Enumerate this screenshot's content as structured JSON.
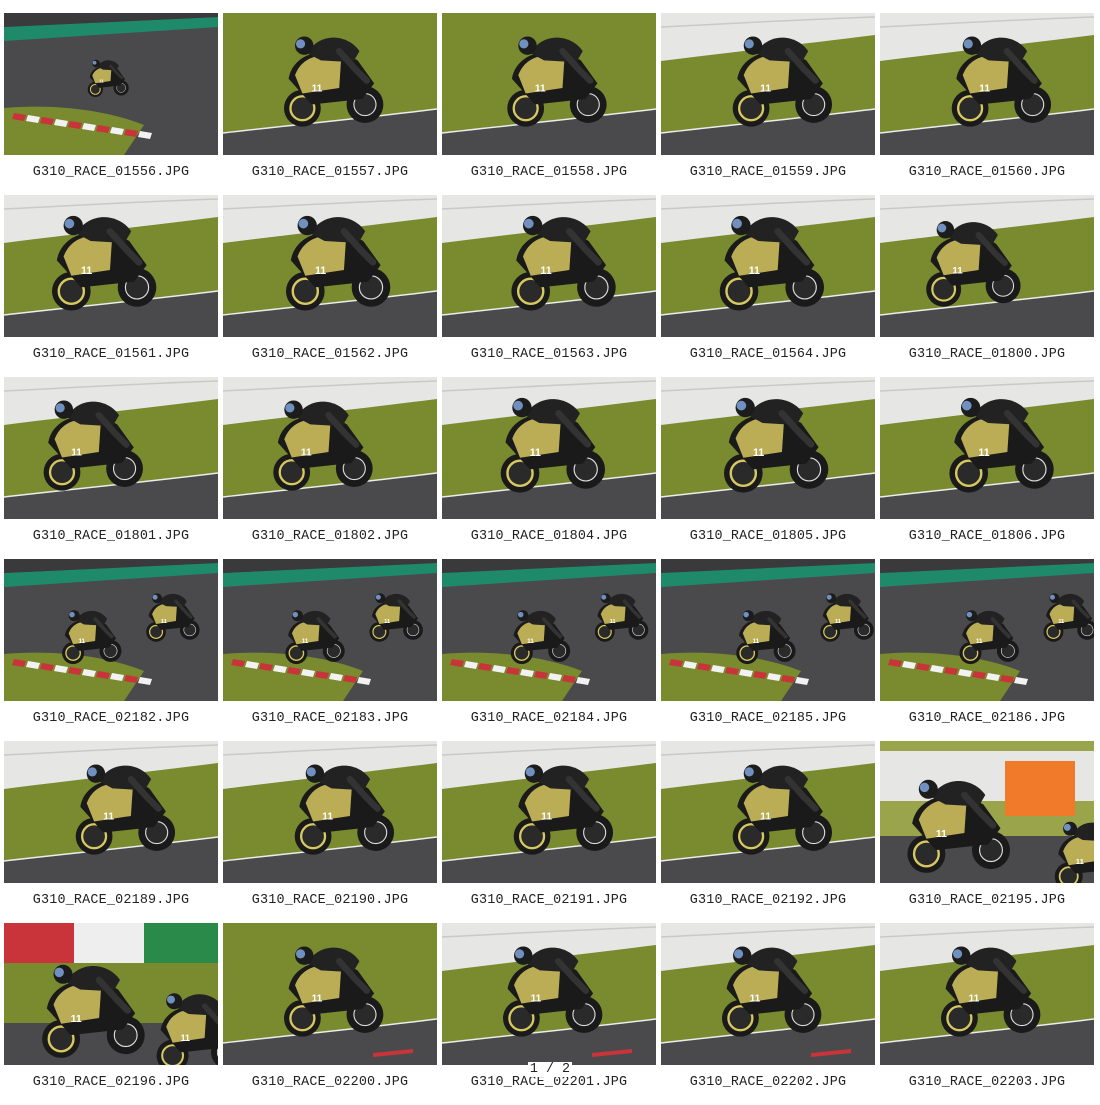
{
  "gallery": {
    "items": [
      {
        "filename": "G310_RACE_01556.JPG",
        "scene": "track-far",
        "x": 0.48,
        "s": 0.38,
        "kerb": true,
        "bg": "track"
      },
      {
        "filename": "G310_RACE_01557.JPG",
        "scene": "grass",
        "x": 0.5,
        "s": 1.0,
        "kerb": false,
        "bg": "grass"
      },
      {
        "filename": "G310_RACE_01558.JPG",
        "scene": "grass",
        "x": 0.52,
        "s": 1.0,
        "kerb": false,
        "bg": "grass"
      },
      {
        "filename": "G310_RACE_01559.JPG",
        "scene": "grass",
        "x": 0.55,
        "s": 1.0,
        "kerb": false,
        "bg": "grass-wall"
      },
      {
        "filename": "G310_RACE_01560.JPG",
        "scene": "grass",
        "x": 0.55,
        "s": 1.0,
        "kerb": false,
        "bg": "grass-wall"
      },
      {
        "filename": "G310_RACE_01561.JPG",
        "scene": "wall",
        "x": 0.45,
        "s": 1.05,
        "kerb": false,
        "bg": "grass-wall"
      },
      {
        "filename": "G310_RACE_01562.JPG",
        "scene": "wall",
        "x": 0.52,
        "s": 1.05,
        "kerb": false,
        "bg": "grass-wall"
      },
      {
        "filename": "G310_RACE_01563.JPG",
        "scene": "wall",
        "x": 0.55,
        "s": 1.05,
        "kerb": false,
        "bg": "grass-wall"
      },
      {
        "filename": "G310_RACE_01564.JPG",
        "scene": "wall",
        "x": 0.5,
        "s": 1.05,
        "kerb": false,
        "bg": "grass-wall"
      },
      {
        "filename": "G310_RACE_01800.JPG",
        "scene": "wall",
        "x": 0.42,
        "s": 0.95,
        "kerb": false,
        "bg": "grass-wall"
      },
      {
        "filename": "G310_RACE_01801.JPG",
        "scene": "wall",
        "x": 0.4,
        "s": 1.0,
        "kerb": false,
        "bg": "grass-wall"
      },
      {
        "filename": "G310_RACE_01802.JPG",
        "scene": "wall",
        "x": 0.45,
        "s": 1.0,
        "kerb": false,
        "bg": "grass-wall"
      },
      {
        "filename": "G310_RACE_01804.JPG",
        "scene": "wall",
        "x": 0.5,
        "s": 1.05,
        "kerb": false,
        "bg": "grass-wall"
      },
      {
        "filename": "G310_RACE_01805.JPG",
        "scene": "wall",
        "x": 0.52,
        "s": 1.05,
        "kerb": false,
        "bg": "grass-wall"
      },
      {
        "filename": "G310_RACE_01806.JPG",
        "scene": "wall",
        "x": 0.55,
        "s": 1.05,
        "kerb": false,
        "bg": "grass-wall"
      },
      {
        "filename": "G310_RACE_02182.JPG",
        "scene": "track-two",
        "x": 0.4,
        "s": 0.55,
        "kerb": true,
        "bg": "track"
      },
      {
        "filename": "G310_RACE_02183.JPG",
        "scene": "track-two",
        "x": 0.42,
        "s": 0.55,
        "kerb": true,
        "bg": "track"
      },
      {
        "filename": "G310_RACE_02184.JPG",
        "scene": "track-two",
        "x": 0.45,
        "s": 0.55,
        "kerb": true,
        "bg": "track"
      },
      {
        "filename": "G310_RACE_02185.JPG",
        "scene": "track-two",
        "x": 0.48,
        "s": 0.55,
        "kerb": true,
        "bg": "track"
      },
      {
        "filename": "G310_RACE_02186.JPG",
        "scene": "track-two",
        "x": 0.5,
        "s": 0.55,
        "kerb": true,
        "bg": "track"
      },
      {
        "filename": "G310_RACE_02189.JPG",
        "scene": "wall",
        "x": 0.55,
        "s": 1.0,
        "kerb": false,
        "bg": "grass-wall"
      },
      {
        "filename": "G310_RACE_02190.JPG",
        "scene": "wall",
        "x": 0.55,
        "s": 1.0,
        "kerb": false,
        "bg": "grass-wall"
      },
      {
        "filename": "G310_RACE_02191.JPG",
        "scene": "wall",
        "x": 0.55,
        "s": 1.0,
        "kerb": false,
        "bg": "grass-wall"
      },
      {
        "filename": "G310_RACE_02192.JPG",
        "scene": "wall",
        "x": 0.55,
        "s": 1.0,
        "kerb": false,
        "bg": "grass-wall"
      },
      {
        "filename": "G310_RACE_02195.JPG",
        "scene": "orange",
        "x": 0.35,
        "s": 1.0,
        "kerb": false,
        "bg": "orange"
      },
      {
        "filename": "G310_RACE_02196.JPG",
        "scene": "flag",
        "x": 0.4,
        "s": 1.0,
        "kerb": false,
        "bg": "flag"
      },
      {
        "filename": "G310_RACE_02200.JPG",
        "scene": "grass",
        "x": 0.5,
        "s": 1.0,
        "kerb": true,
        "bg": "grass"
      },
      {
        "filename": "G310_RACE_02201.JPG",
        "scene": "grass",
        "x": 0.5,
        "s": 1.0,
        "kerb": true,
        "bg": "grass-wall"
      },
      {
        "filename": "G310_RACE_02202.JPG",
        "scene": "grass",
        "x": 0.5,
        "s": 1.0,
        "kerb": true,
        "bg": "grass-wall"
      },
      {
        "filename": "G310_RACE_02203.JPG",
        "scene": "grass",
        "x": 0.5,
        "s": 1.0,
        "kerb": false,
        "bg": "grass-wall"
      }
    ]
  },
  "pager": {
    "text": "1 / 2"
  },
  "colors": {
    "grass": "#7a8a2e",
    "grass_dark": "#6b7a26",
    "asphalt": "#4a4a4c",
    "asphalt_dark": "#3a3a3c",
    "wall": "#e6e6e4",
    "kerb_red": "#c8343a",
    "kerb_white": "#f2f2f2",
    "green_stripe": "#1f8a6a",
    "bike_yellow": "#d8c860",
    "bike_black": "#1a1a1a",
    "orange": "#f07a2a"
  }
}
